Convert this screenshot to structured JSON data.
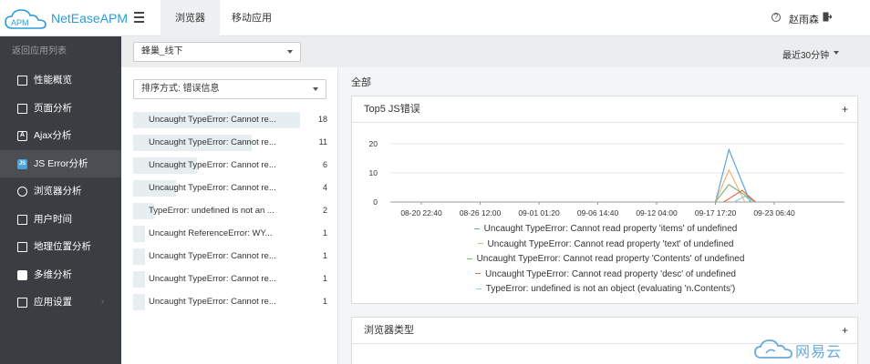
{
  "header": {
    "brand": "NetEaseAPM",
    "logo_text": "APM",
    "tabs": [
      {
        "label": "浏览器",
        "active": true
      },
      {
        "label": "移动应用",
        "active": false
      }
    ],
    "user": "赵雨森"
  },
  "sidebar": {
    "back_label": "返回应用列表",
    "items": [
      {
        "label": "性能概览",
        "icon": "monitor-icon"
      },
      {
        "label": "页面分析",
        "icon": "page-icon"
      },
      {
        "label": "Ajax分析",
        "icon": "ajax-icon"
      },
      {
        "label": "JS Error分析",
        "icon": "js-icon",
        "active": true
      },
      {
        "label": "浏览器分析",
        "icon": "browser-icon"
      },
      {
        "label": "用户时间",
        "icon": "user-time-icon"
      },
      {
        "label": "地理位置分析",
        "icon": "location-icon"
      },
      {
        "label": "多维分析",
        "icon": "puzzle-icon"
      },
      {
        "label": "应用设置",
        "icon": "settings-icon",
        "has_chevron": true
      }
    ],
    "chevron": "›"
  },
  "toolbar": {
    "app_select": "蜂巢_线下",
    "time_range": "最近30分钟"
  },
  "error_list": {
    "sort_select": "排序方式: 错误信息",
    "items": [
      {
        "text": "Uncaught TypeError: Cannot re...",
        "count": "18",
        "fraction": 0.86
      },
      {
        "text": "Uncaught TypeError: Cannot re...",
        "count": "11",
        "fraction": 0.61
      },
      {
        "text": "Uncaught TypeError: Cannot re...",
        "count": "6",
        "fraction": 0.33
      },
      {
        "text": "Uncaught TypeError: Cannot re...",
        "count": "4",
        "fraction": 0.22
      },
      {
        "text": "TypeError: undefined is not an ...",
        "count": "2",
        "fraction": 0.11
      },
      {
        "text": "Uncaught ReferenceError: WY...",
        "count": "1",
        "fraction": 0.06
      },
      {
        "text": "Uncaught TypeError: Cannot re...",
        "count": "1",
        "fraction": 0.06
      },
      {
        "text": "Uncaught TypeError: Cannot re...",
        "count": "1",
        "fraction": 0.06
      },
      {
        "text": "Uncaught TypeError: Cannot re...",
        "count": "1",
        "fraction": 0.06
      }
    ]
  },
  "main": {
    "section_title": "全部",
    "chart_card_title": "Top5 JS错误",
    "browser_card_title": "浏览器类型",
    "plus": "+"
  },
  "chart_data": {
    "type": "line",
    "title": "Top5 JS错误",
    "x_ticks": [
      "08-20 22:40",
      "08-26 12:00",
      "09-01 01:20",
      "09-06 14:40",
      "09-12 04:00",
      "09-17 17:20",
      "09-23 06:40"
    ],
    "ylim": [
      0,
      20
    ],
    "y_ticks": [
      0,
      10,
      20
    ],
    "grid": true,
    "legend_position": "bottom",
    "series": [
      {
        "name": "Uncaught TypeError: Cannot read property 'items' of undefined",
        "color": "#5da5da",
        "points": [
          [
            "09-17 17:20",
            0
          ],
          [
            "09-19 00:00",
            18
          ],
          [
            "09-21 00:00",
            0
          ]
        ]
      },
      {
        "name": "Uncaught TypeError: Cannot read property 'text' of undefined",
        "color": "#f0b27a",
        "points": [
          [
            "09-17 17:20",
            0
          ],
          [
            "09-19 00:00",
            11
          ],
          [
            "09-20 12:00",
            0
          ]
        ]
      },
      {
        "name": "Uncaught TypeError: Cannot read property 'Contents' of undefined",
        "color": "#7fb77e",
        "points": [
          [
            "09-17 17:20",
            0
          ],
          [
            "09-19 00:00",
            6
          ],
          [
            "09-20 06:00",
            3
          ],
          [
            "09-21 12:00",
            0
          ]
        ]
      },
      {
        "name": "Uncaught TypeError: Cannot read property 'desc' of undefined",
        "color": "#e06c4c",
        "points": [
          [
            "09-18 12:00",
            0
          ],
          [
            "09-20 06:00",
            4
          ],
          [
            "09-21 12:00",
            0
          ]
        ]
      },
      {
        "name": "TypeError: undefined is not an object (evaluating 'n.Contents')",
        "color": "#8dc7e8",
        "points": [
          [
            "09-19 12:00",
            0
          ],
          [
            "09-20 12:00",
            2
          ],
          [
            "09-21 06:00",
            0
          ]
        ]
      }
    ]
  },
  "watermark": "网易云",
  "colors": {
    "sidebar_bg": "#3a3d41",
    "accent": "#2b9bd9",
    "bar_bg": "#e6eef0"
  }
}
